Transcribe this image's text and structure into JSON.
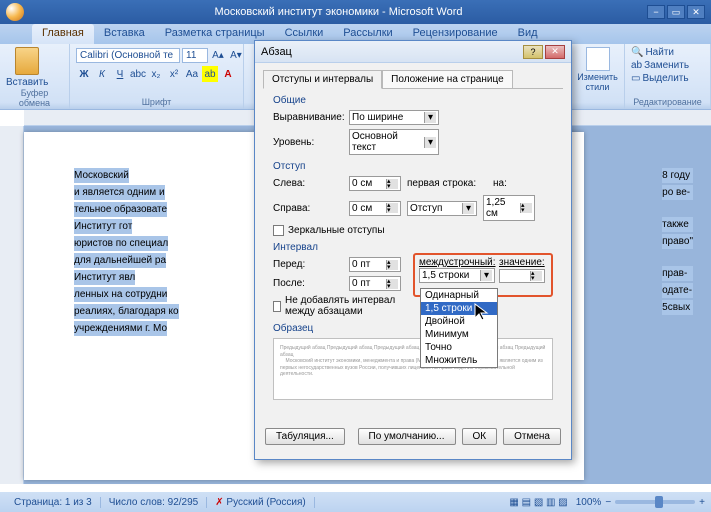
{
  "titlebar": {
    "title": "Московский институт экономики - Microsoft Word"
  },
  "tabs": {
    "items": [
      {
        "label": "Главная",
        "active": true
      },
      {
        "label": "Вставка"
      },
      {
        "label": "Разметка страницы"
      },
      {
        "label": "Ссылки"
      },
      {
        "label": "Рассылки"
      },
      {
        "label": "Рецензирование"
      },
      {
        "label": "Вид"
      }
    ]
  },
  "ribbon": {
    "clipboard": {
      "label": "Буфер обмена",
      "paste": "Вставить"
    },
    "font": {
      "label": "Шрифт",
      "name": "Calibri (Основной те",
      "size": "11"
    },
    "styles": {
      "label": "Изменить стили"
    },
    "editing": {
      "label": "Редактирование",
      "find": "Найти",
      "replace": "Заменить",
      "select": "Выделить"
    }
  },
  "document": {
    "lines": [
      "Московский",
      "и является одним и",
      "тельное образовате",
      "    Институт гот",
      "юристов по специал",
      "для дальнейшей ра",
      "    Институт явл",
      "ленных на сотрудни",
      "реалиях, благодаря ко",
      "учреждениями г. Мо"
    ],
    "right_lines": [
      "8 году",
      "ро ве-",
      "также",
      "право\"",
      "прав-",
      "одате-",
      "5свых"
    ]
  },
  "dialog": {
    "title": "Абзац",
    "tabs": {
      "t1": "Отступы и интервалы",
      "t2": "Положение на странице"
    },
    "general": {
      "header": "Общие",
      "alignment_label": "Выравнивание:",
      "alignment": "По ширине",
      "level_label": "Уровень:",
      "level": "Основной текст"
    },
    "indent": {
      "header": "Отступ",
      "left_label": "Слева:",
      "left": "0 см",
      "right_label": "Справа:",
      "right": "0 см",
      "first_label": "первая строка:",
      "first": "Отступ",
      "by_label": "на:",
      "by": "1,25 см",
      "mirror": "Зеркальные отступы"
    },
    "spacing": {
      "header": "Интервал",
      "before_label": "Перед:",
      "before": "0 пт",
      "after_label": "После:",
      "after": "0 пт",
      "line_label": "междустрочный:",
      "line": "1,5 строки",
      "value_label": "значение:",
      "noadd": "Не добавлять интервал между абзацами",
      "options": [
        "Одинарный",
        "1,5 строки",
        "Двойной",
        "Минимум",
        "Точно",
        "Множитель"
      ]
    },
    "preview_header": "Образец",
    "buttons": {
      "tabs": "Табуляция...",
      "default": "По умолчанию...",
      "ok": "ОК",
      "cancel": "Отмена"
    }
  },
  "statusbar": {
    "page": "Страница: 1 из 3",
    "words": "Число слов: 92/295",
    "lang": "Русский (Россия)",
    "zoom": "100%"
  }
}
